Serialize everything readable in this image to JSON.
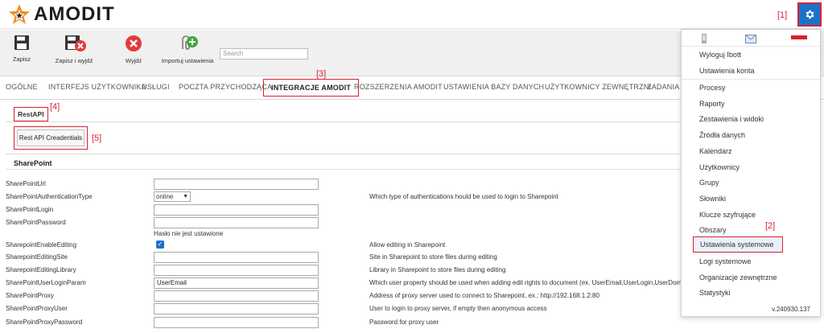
{
  "header": {
    "logo_text": "AMODIT",
    "annot_1": "[1]"
  },
  "toolbar": {
    "save_label": "Zapisz",
    "save_exit_label": "Zapisz i wyjdź",
    "exit_label": "Wyjdź",
    "import_label": "Importuj ustawienia",
    "search_placeholder": "Search"
  },
  "tabs": [
    {
      "label": "OGÓLNE"
    },
    {
      "label": "INTERFEJS UŻYTKOWNIKA"
    },
    {
      "label": "USŁUGI"
    },
    {
      "label": "POCZTA PRZYCHODZĄCA"
    },
    {
      "label": "INTEGRACJE AMODIT"
    },
    {
      "label": "ROZSZERZENIA AMODIT"
    },
    {
      "label": "USTAWIENIA BAZY DANYCH"
    },
    {
      "label": "UŻYTKOWNICY ZEWNĘTRZNI"
    },
    {
      "label": "ZADANIA"
    }
  ],
  "annotations": {
    "a2": "[2]",
    "a3": "[3]",
    "a4": "[4]",
    "a5": "[5]"
  },
  "restapi": {
    "section_title": "RestAPI",
    "button_label": "Rest API Creadentials"
  },
  "sharepoint": {
    "section_title": "SharePoint",
    "rows": [
      {
        "label": "SharePointUrl",
        "value": "",
        "desc": ""
      },
      {
        "label": "SharePointAuthenticationType",
        "value": "online",
        "desc": "Which type of authentications hould be used to login to Sharepoint"
      },
      {
        "label": "SharePointLogin",
        "value": "",
        "desc": ""
      },
      {
        "label": "SharePointPassword",
        "value": "",
        "desc": ""
      },
      {
        "label": "SharepointEnableEditing",
        "value": "",
        "desc": "Allow editing in Sharepoint"
      },
      {
        "label": "SharepointEditingSite",
        "value": "",
        "desc": "Site in Sharepoint to store files during editing"
      },
      {
        "label": "SharepointEditingLibrary",
        "value": "",
        "desc": "Library in Sharepoint to store files during editing"
      },
      {
        "label": "SharePointUserLoginParam",
        "value": "UserEmail",
        "desc": "Which user property should be used when adding edit rights to document (ex. UserEmail,UserLogin,UserDomain"
      },
      {
        "label": "SharePointProxy",
        "value": "",
        "desc": "Address of proxy server used to connect to Sharepoint, ex.: http://192.168.1.2:80"
      },
      {
        "label": "SharePointProxyUser",
        "value": "",
        "desc": "User to login to proxy server, if empty then anonymous access"
      },
      {
        "label": "SharePointProxyPassword",
        "value": "",
        "desc": "Password for proxy user"
      }
    ],
    "password_hint": "Hasło nie jest ustawione"
  },
  "menu": {
    "items": [
      {
        "label": "Wyloguj Ibott"
      },
      {
        "label": "Ustawienia konta"
      },
      {
        "label": "Procesy"
      },
      {
        "label": "Raporty"
      },
      {
        "label": "Zestawienia i widoki"
      },
      {
        "label": "Źródła danych"
      },
      {
        "label": "Kalendarz"
      },
      {
        "label": "Użytkownicy"
      },
      {
        "label": "Grupy"
      },
      {
        "label": "Słowniki"
      },
      {
        "label": "Klucze szyfrujące"
      },
      {
        "label": "Obszary"
      },
      {
        "label": "Ustawienia systemowe"
      },
      {
        "label": "Logi systemowe"
      },
      {
        "label": "Organizacje zewnętrzne"
      },
      {
        "label": "Statystyki"
      }
    ],
    "version": "v.240930.137"
  },
  "colors": {
    "accent_blue": "#1a73c9",
    "annotation_red": "#d8202f"
  }
}
